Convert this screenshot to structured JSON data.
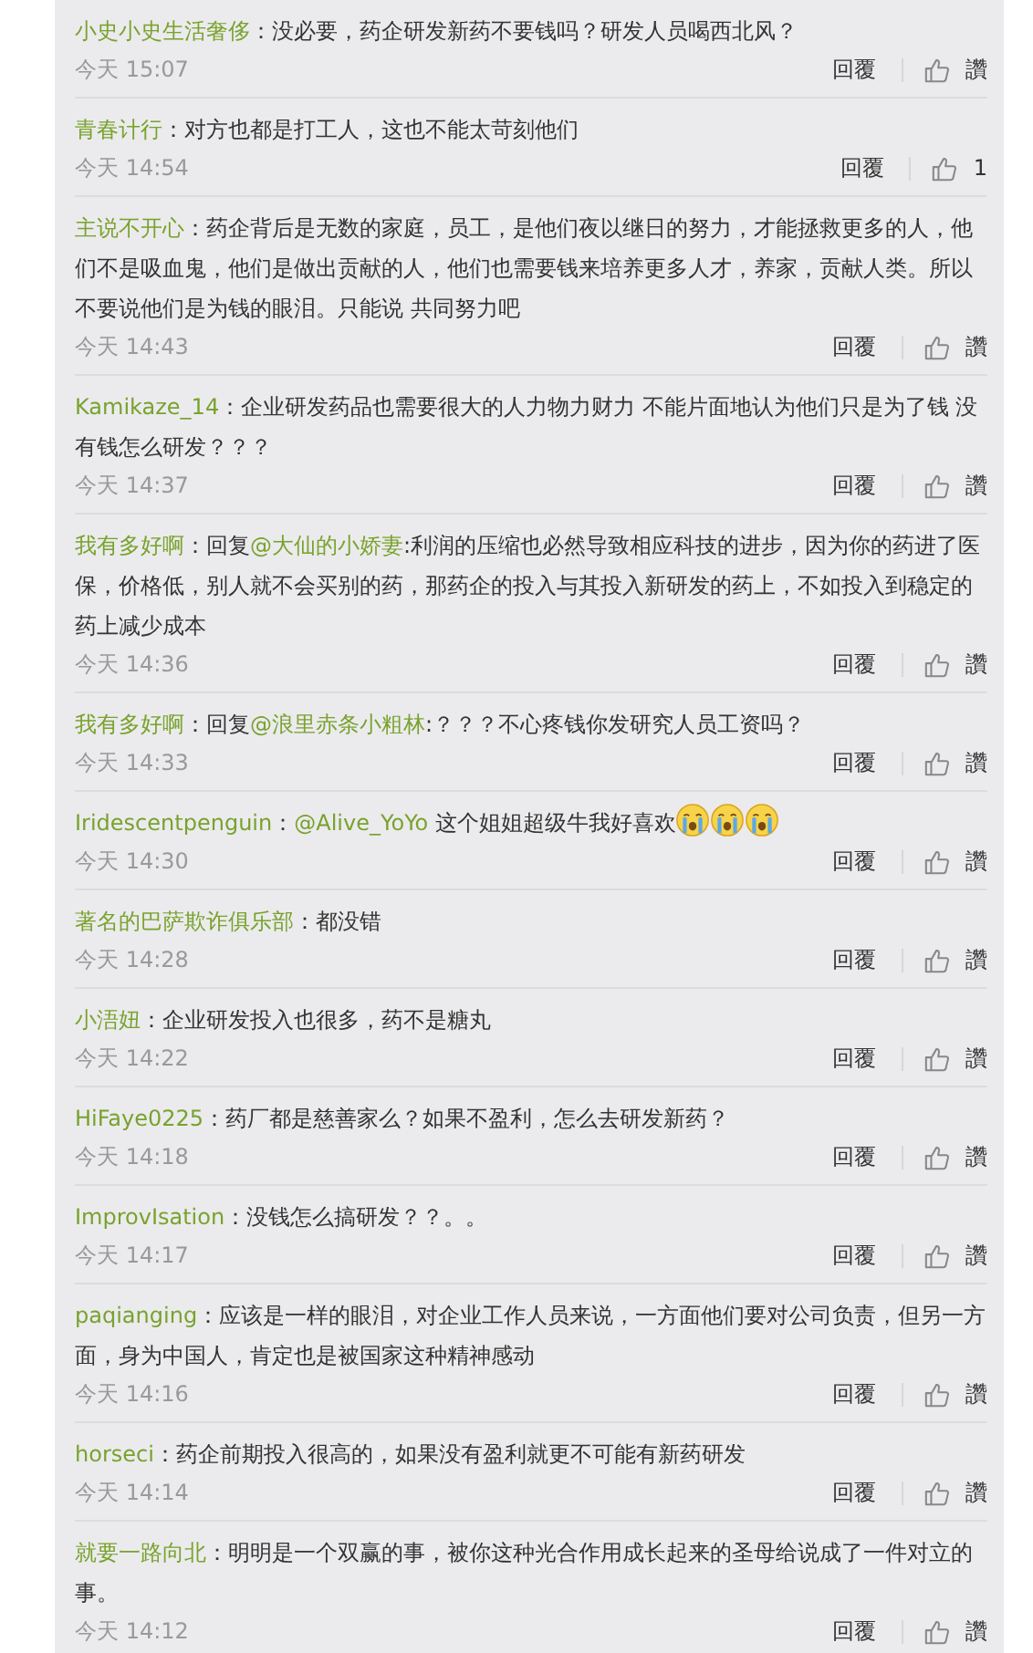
{
  "comments": [
    {
      "name": "小史小史生活奢侈",
      "text": [
        {
          "kind": "plain",
          "text": "：没必要，药企研发新药不要钱吗？研发人员喝西北风？"
        }
      ],
      "time": "今天 15:07",
      "reply": "回覆",
      "likes": "讚"
    },
    {
      "name": "青春计行",
      "text": [
        {
          "kind": "plain",
          "text": "：对方也都是打工人，这也不能太苛刻他们"
        }
      ],
      "time": "今天 14:54",
      "reply": "回覆",
      "likes": "1"
    },
    {
      "name": "主说不开心",
      "text": [
        {
          "kind": "plain",
          "text": "：药企背后是无数的家庭，员工，是他们夜以继日的努力，才能拯救更多的人，他们不是吸血鬼，他们是做出贡献的人，他们也需要钱来培养更多人才，养家，贡献人类。所以不要说他们是为钱的眼泪。只能说 共同努力吧"
        }
      ],
      "time": "今天 14:43",
      "reply": "回覆",
      "likes": "讚"
    },
    {
      "name": "Kamikaze_14",
      "text": [
        {
          "kind": "plain",
          "text": "：企业研发药品也需要很大的人力物力财力 不能片面地认为他们只是为了钱 没有钱怎么研发？？？"
        }
      ],
      "time": "今天 14:37",
      "reply": "回覆",
      "likes": "讚"
    },
    {
      "name": "我有多好啊",
      "text": [
        {
          "kind": "plain",
          "text": "：回复"
        },
        {
          "kind": "mention",
          "text": "@大仙的小娇妻"
        },
        {
          "kind": "plain",
          "text": ":利润的压缩也必然导致相应科技的进步，因为你的药进了医保，价格低，别人就不会买别的药，那药企的投入与其投入新研发的药上，不如投入到稳定的药上减少成本"
        }
      ],
      "time": "今天 14:36",
      "reply": "回覆",
      "likes": "讚"
    },
    {
      "name": "我有多好啊",
      "text": [
        {
          "kind": "plain",
          "text": "：回复"
        },
        {
          "kind": "mention",
          "text": "@浪里赤条小粗林"
        },
        {
          "kind": "plain",
          "text": ":？？？不心疼钱你发研究人员工资吗？"
        }
      ],
      "time": "今天 14:33",
      "reply": "回覆",
      "likes": "讚"
    },
    {
      "name": "Iridescentpenguin",
      "text": [
        {
          "kind": "plain",
          "text": "："
        },
        {
          "kind": "mention",
          "text": "@Alive_YoYo"
        },
        {
          "kind": "plain",
          "text": " 这个姐姐超级牛我好喜欢"
        },
        {
          "kind": "emoji"
        },
        {
          "kind": "emoji"
        },
        {
          "kind": "emoji"
        }
      ],
      "time": "今天 14:30",
      "reply": "回覆",
      "likes": "讚"
    },
    {
      "name": "著名的巴萨欺诈俱乐部",
      "text": [
        {
          "kind": "plain",
          "text": "：都没错"
        }
      ],
      "time": "今天 14:28",
      "reply": "回覆",
      "likes": "讚"
    },
    {
      "name": "小浯妞",
      "text": [
        {
          "kind": "plain",
          "text": "：企业研发投入也很多，药不是糖丸"
        }
      ],
      "time": "今天 14:22",
      "reply": "回覆",
      "likes": "讚"
    },
    {
      "name": "HiFaye0225",
      "text": [
        {
          "kind": "plain",
          "text": "：药厂都是慈善家么？如果不盈利，怎么去研发新药？"
        }
      ],
      "time": "今天 14:18",
      "reply": "回覆",
      "likes": "讚"
    },
    {
      "name": "ImprovIsation",
      "text": [
        {
          "kind": "plain",
          "text": "：没钱怎么搞研发？？。。"
        }
      ],
      "time": "今天 14:17",
      "reply": "回覆",
      "likes": "讚"
    },
    {
      "name": "paqianging",
      "text": [
        {
          "kind": "plain",
          "text": "：应该是一样的眼泪，对企业工作人员来说，一方面他们要对公司负责，但另一方面，身为中国人，肯定也是被国家这种精神感动"
        }
      ],
      "time": "今天 14:16",
      "reply": "回覆",
      "likes": "讚"
    },
    {
      "name": "horseci",
      "text": [
        {
          "kind": "plain",
          "text": "：药企前期投入很高的，如果没有盈利就更不可能有新药研发"
        }
      ],
      "time": "今天 14:14",
      "reply": "回覆",
      "likes": "讚"
    },
    {
      "name": "就要一路向北",
      "text": [
        {
          "kind": "plain",
          "text": "：明明是一个双赢的事，被你这种光合作用成长起来的圣母给说成了一件对立的事。"
        }
      ],
      "time": "今天 14:12",
      "reply": "回覆",
      "likes": "讚"
    }
  ]
}
